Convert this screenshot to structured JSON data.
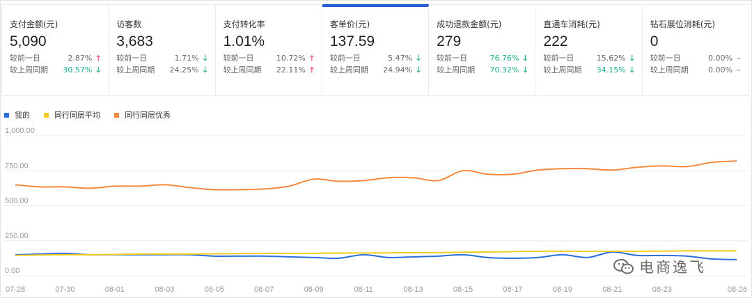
{
  "metrics": [
    {
      "title": "支付金额(元)",
      "value": "5,090",
      "rows": [
        {
          "label": "较前一日",
          "pct": "2.87%",
          "dir": "up"
        },
        {
          "label": "较上周同期",
          "pct": "30.57%",
          "dir": "down"
        }
      ]
    },
    {
      "title": "访客数",
      "value": "3,683",
      "rows": [
        {
          "label": "较前一日",
          "pct": "1.71%",
          "dir": "down"
        },
        {
          "label": "较上周同期",
          "pct": "24.25%",
          "dir": "down"
        }
      ]
    },
    {
      "title": "支付转化率",
      "value": "1.01%",
      "rows": [
        {
          "label": "较前一日",
          "pct": "10.72%",
          "dir": "up"
        },
        {
          "label": "较上周同期",
          "pct": "22.11%",
          "dir": "up"
        }
      ]
    },
    {
      "title": "客单价(元)",
      "value": "137.59",
      "rows": [
        {
          "label": "较前一日",
          "pct": "5.47%",
          "dir": "down"
        },
        {
          "label": "较上周同期",
          "pct": "24.94%",
          "dir": "down"
        }
      ]
    },
    {
      "title": "成功退款金额(元)",
      "value": "279",
      "rows": [
        {
          "label": "较前一日",
          "pct": "76.76%",
          "dir": "down"
        },
        {
          "label": "较上周同期",
          "pct": "70.32%",
          "dir": "down"
        }
      ]
    },
    {
      "title": "直通车消耗(元)",
      "value": "222",
      "rows": [
        {
          "label": "较前一日",
          "pct": "15.62%",
          "dir": "down"
        },
        {
          "label": "较上周同期",
          "pct": "34.15%",
          "dir": "down"
        }
      ]
    },
    {
      "title": "钻石展位消耗(元)",
      "value": "0",
      "rows": [
        {
          "label": "较前一日",
          "pct": "0.00%",
          "dir": "flat"
        },
        {
          "label": "较上周同期",
          "pct": "0.00%",
          "dir": "flat"
        }
      ]
    }
  ],
  "active_metric_index": 3,
  "arrows": {
    "up": "🡑",
    "down": "🡓",
    "flat": "–"
  },
  "colors": {
    "mine": "#2a6fdb",
    "avg": "#f2cc1f",
    "best": "#f5893d",
    "down": "#1eae8e",
    "up": "#f04864",
    "accent": "#2a5bd6"
  },
  "watermark": "电商逸飞",
  "chart_data": {
    "type": "line",
    "categories": [
      "07-28",
      "07-29",
      "07-30",
      "07-31",
      "08-01",
      "08-02",
      "08-03",
      "08-04",
      "08-05",
      "08-06",
      "08-07",
      "08-08",
      "08-09",
      "08-10",
      "08-11",
      "08-12",
      "08-13",
      "08-14",
      "08-15",
      "08-16",
      "08-17",
      "08-18",
      "08-19",
      "08-20",
      "08-21",
      "08-22",
      "08-23",
      "08-24",
      "08-25",
      "08-26"
    ],
    "tick_labels": [
      "07-28",
      "07-30",
      "08-01",
      "08-03",
      "08-05",
      "08-07",
      "08-09",
      "08-11",
      "08-13",
      "08-15",
      "08-17",
      "08-19",
      "08-21",
      "08-23",
      "08-26"
    ],
    "y_ticks": [
      "0.00",
      "250.00",
      "500.00",
      "750.00",
      "1,000.00"
    ],
    "ylim": [
      0,
      1000
    ],
    "grid": true,
    "legend_position": "top-left",
    "series": [
      {
        "name": "我的",
        "color": "#2a6fdb",
        "values": [
          150,
          155,
          160,
          150,
          150,
          150,
          150,
          150,
          140,
          140,
          140,
          135,
          130,
          125,
          150,
          130,
          135,
          140,
          150,
          130,
          125,
          130,
          150,
          130,
          170,
          145,
          145,
          140,
          120,
          115
        ]
      },
      {
        "name": "同行同层平均",
        "color": "#f2cc1f",
        "values": [
          145,
          148,
          150,
          150,
          152,
          155,
          155,
          155,
          157,
          158,
          160,
          160,
          160,
          162,
          163,
          163,
          165,
          165,
          168,
          170,
          172,
          175,
          175,
          175,
          175,
          175,
          176,
          178,
          178,
          178
        ]
      },
      {
        "name": "同行同层优秀",
        "color": "#f5893d",
        "values": [
          650,
          635,
          635,
          625,
          640,
          640,
          650,
          630,
          615,
          615,
          620,
          640,
          690,
          675,
          680,
          700,
          700,
          680,
          750,
          725,
          725,
          755,
          765,
          765,
          755,
          775,
          785,
          780,
          810,
          820
        ]
      }
    ]
  }
}
